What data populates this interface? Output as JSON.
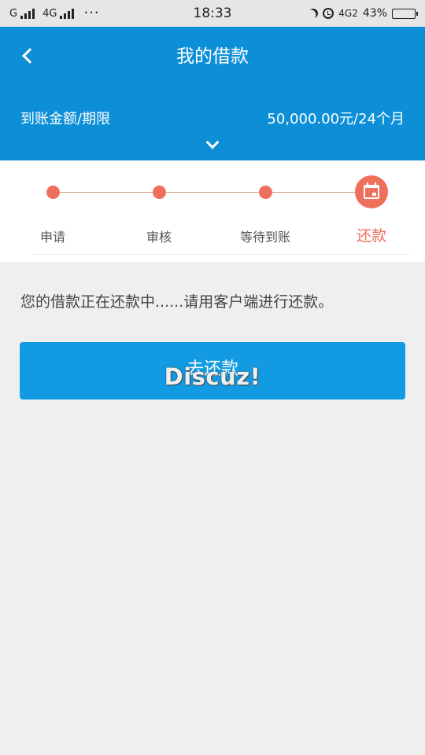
{
  "status_bar": {
    "carrier1": "G",
    "carrier2": "4G",
    "dots": "···",
    "time": "18:33",
    "network": "4G2",
    "battery": "43%",
    "battery_level": 0.43
  },
  "header": {
    "title": "我的借款",
    "amount_label": "到账金额/期限",
    "amount_value": "50,000.00元/24个月"
  },
  "steps": [
    {
      "label": "申请",
      "state": "done"
    },
    {
      "label": "审核",
      "state": "done"
    },
    {
      "label": "等待到账",
      "state": "done"
    },
    {
      "label": "还款",
      "state": "current"
    }
  ],
  "main": {
    "message": "您的借款正在还款中......请用客户端进行还款。",
    "button_label": "去还款",
    "watermark": "Discuz!"
  },
  "colors": {
    "header": "#0d8fd8",
    "accent": "#ee6f5b",
    "button": "#129be2",
    "background": "#efefef"
  }
}
